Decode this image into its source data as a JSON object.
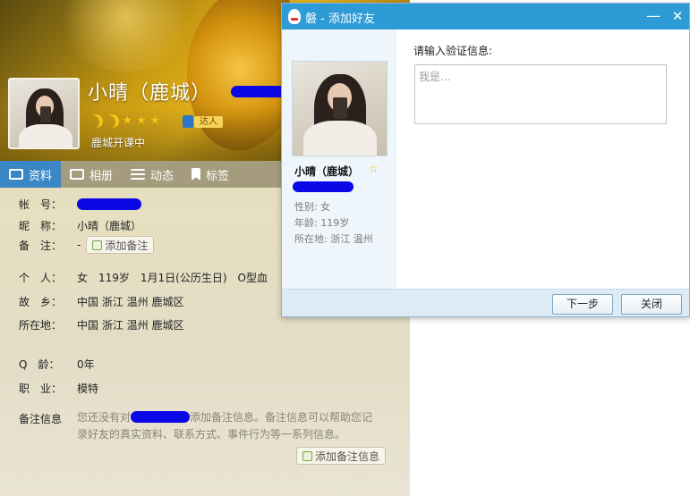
{
  "profile": {
    "nickname": "小晴（鹿城）",
    "status": "鹿城开课中",
    "badge": "达人",
    "level_icons": [
      "moon-icon",
      "moon-icon",
      "star-icon",
      "star-icon",
      "star-icon"
    ],
    "tabs": [
      {
        "label": "资料",
        "icon": "id-card-icon",
        "active": true
      },
      {
        "label": "相册",
        "icon": "photo-album-icon",
        "active": false
      },
      {
        "label": "动态",
        "icon": "feed-list-icon",
        "active": false
      },
      {
        "label": "标签",
        "icon": "bookmark-icon",
        "active": false
      }
    ],
    "fields": {
      "account_label": "帐　号：",
      "nickname_label": "昵　称：",
      "nickname_value": "小晴（鹿城）",
      "remark_label": "备　注：",
      "remark_value": "-",
      "add_remark_button": "添加备注",
      "personal_label": "个　人：",
      "personal_value": "女　119岁　1月1日(公历生日)　O型血",
      "hometown_label": "故　乡：",
      "hometown_value": "中国 浙江 温州 鹿城区",
      "location_label": "所在地：",
      "location_value": "中国 浙江 温州 鹿城区",
      "qage_label": "Q　龄：",
      "qage_value": "0年",
      "job_label": "职　业：",
      "job_value": "模特",
      "remark_info_label": "备注信息",
      "remark_info_text_1": "您还没有对",
      "remark_info_text_2": "添加备注信息。备注信息可以帮助您记录好友的真实资料、联系方式、事件行为等一系列信息。",
      "add_remark_info_button": "添加备注信息"
    },
    "colors": {
      "active_tab": "#3b86c4",
      "redaction": "#0b08e8"
    }
  },
  "dialog": {
    "title": "磐 - 添加好友",
    "minimize": "—",
    "close": "✕",
    "contact_name": "小晴（鹿城）",
    "gender": "性别: 女",
    "age": "年龄: 119岁",
    "location": "所在地: 浙江  温州",
    "verify_label": "请输入验证信息:",
    "verify_placeholder": "我是...",
    "next_button": "下一步",
    "close_button": "关闭",
    "colors": {
      "titlebar": "#2d9bd6",
      "side_panel": "#eef6fc",
      "footer": "#deeaf4"
    }
  }
}
